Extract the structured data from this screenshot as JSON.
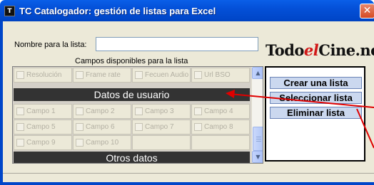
{
  "window": {
    "title": "TC Catalogador: gestión de listas para Excel",
    "app_icon_glyph": "T",
    "close_glyph": "✕"
  },
  "form": {
    "nombre_label": "Nombre para la lista:",
    "nombre_value": "",
    "campos_label": "Campos disponibles para la lista"
  },
  "logo": {
    "part1": "Todo",
    "part2": "el",
    "part3": "Cine.net"
  },
  "fields": {
    "top_row": [
      "Resolución",
      "Frame rate",
      "Fecuen Audio",
      "Url BSO"
    ],
    "section_user": "Datos de usuario",
    "user_rows": [
      [
        "Campo 1",
        "Campo 2",
        "Campo 3",
        "Campo 4"
      ],
      [
        "Campo 5",
        "Campo 6",
        "Campo 7",
        "Campo 8"
      ],
      [
        "Campo 9",
        "Campo 10",
        "",
        ""
      ]
    ],
    "section_other": "Otros datos"
  },
  "scrollbar": {
    "up_glyph": "▲",
    "down_glyph": "▼"
  },
  "actions": {
    "crear": "Crear una lista",
    "seleccionar": "Seleccionar lista",
    "eliminar": "Eliminar lista"
  },
  "colors": {
    "titlebar": "#0450d8",
    "section_bar": "#333333",
    "action_button": "#cbd8ef",
    "annotation_arrow": "#e00000"
  }
}
